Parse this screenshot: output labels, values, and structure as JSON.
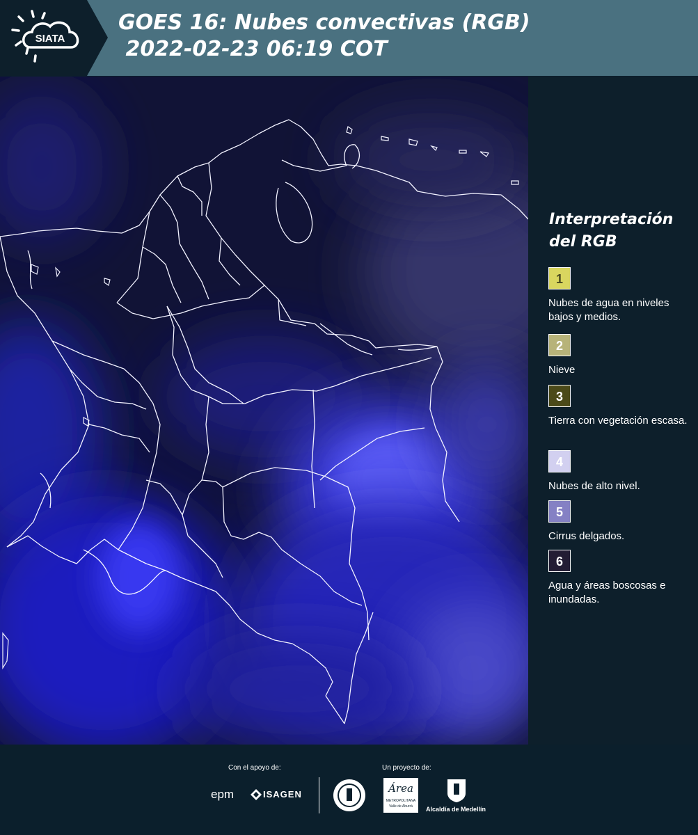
{
  "header": {
    "brand": "SIATA",
    "title": "GOES 16: Nubes convectivas (RGB)\n 2022-02-23 06:19 COT"
  },
  "legend": {
    "title": "Interpretación del RGB",
    "items": [
      {
        "number": "1",
        "label": "Nubes de agua en niveles bajos y medios.",
        "color": "#d9d65f",
        "text_color": "#4a4a20"
      },
      {
        "number": "2",
        "label": "Nieve",
        "color": "#b7b379",
        "text_color": "#ffffff"
      },
      {
        "number": "3",
        "label": "Tierra con vegetación escasa.",
        "color": "#4b4a19",
        "text_color": "#ffffff"
      },
      {
        "number": "4",
        "label": "Nubes de alto nivel.",
        "color": "#d2d0f0",
        "text_color": "#ffffff"
      },
      {
        "number": "5",
        "label": "Cirrus delgados.",
        "color": "#8581c4",
        "text_color": "#ffffff"
      },
      {
        "number": "6",
        "label": "Agua y áreas boscosas e inundadas.",
        "color": "#231d34",
        "text_color": "#ffffff"
      }
    ]
  },
  "footer": {
    "support_label": "Con el apoyo de:",
    "project_label": "Un proyecto de:",
    "sponsor_1": "epm",
    "sponsor_2": "ISAGEN",
    "partner_area_title": "Área",
    "partner_area_sub": "METROPOLITANA",
    "partner_area_sub2": "Valle de Aburrá",
    "partner_alcaldia": "Alcaldía de Medellín"
  },
  "colors": {
    "header_bg": "#4a7180",
    "panel_bg": "#0d1f2b",
    "map_bg": "#111336",
    "cloud_blue": "#3f3fe0"
  }
}
